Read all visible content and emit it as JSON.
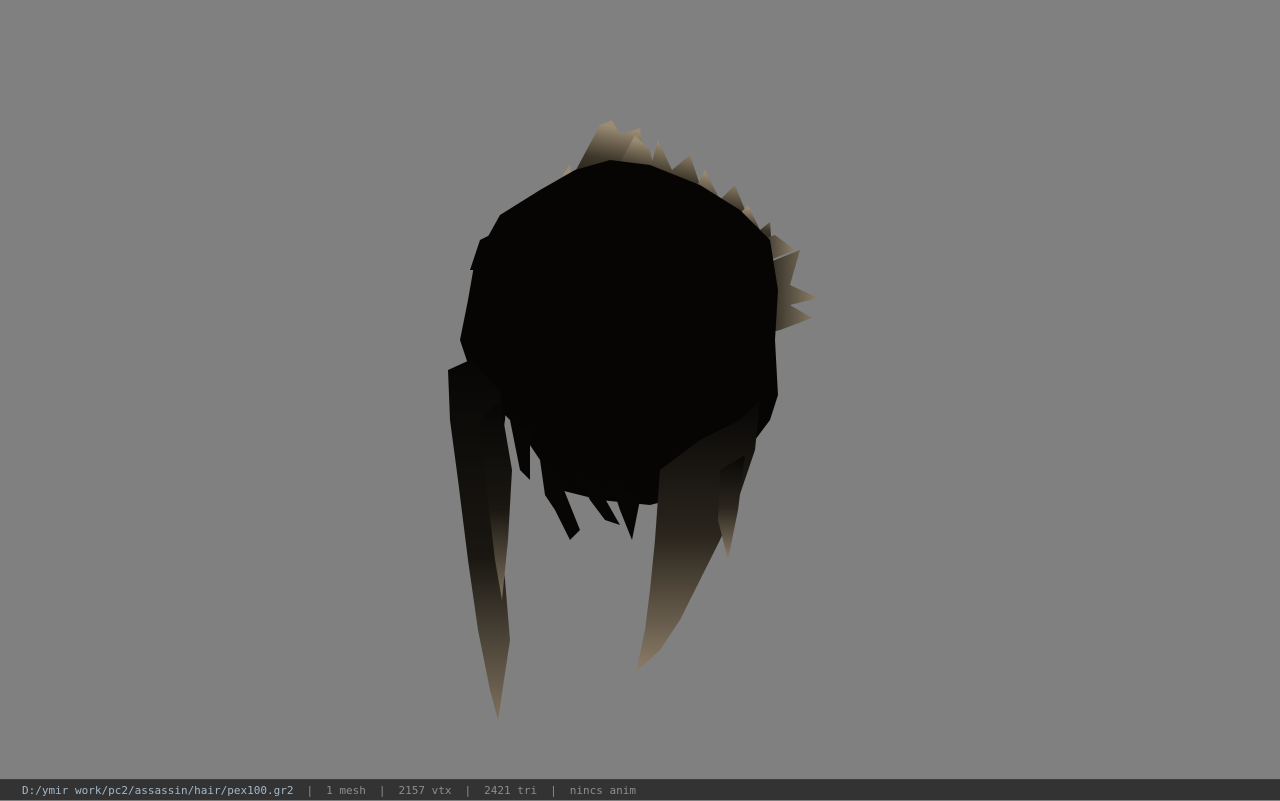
{
  "viewport": {
    "background_color": "#808080",
    "model_colors": {
      "hair_dark": "#060504",
      "hair_tip": "#8b7d68"
    }
  },
  "status_bar": {
    "file_path": "D:/ymir work/pc2/assassin/hair/pex100.gr2",
    "separator": "|",
    "mesh_count": "1 mesh",
    "vertex_count": "2157 vtx",
    "triangle_count": "2421 tri",
    "anim_status": "nincs anim"
  }
}
